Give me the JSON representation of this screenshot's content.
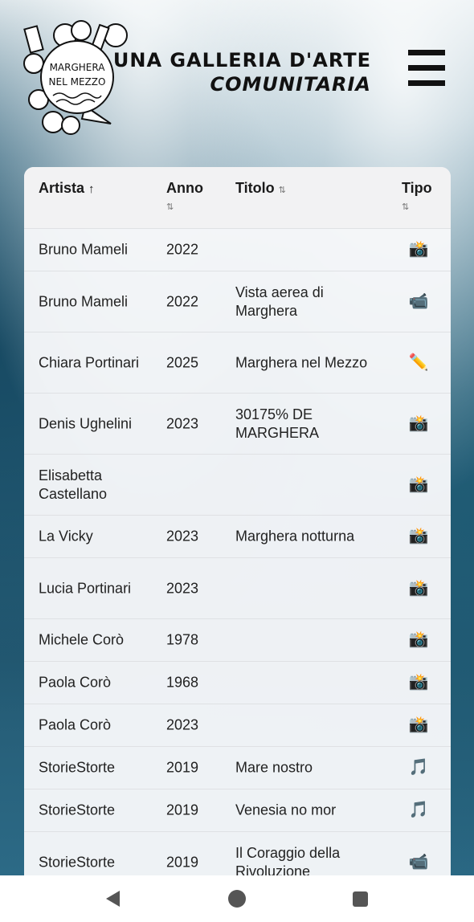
{
  "header": {
    "logo_text_1": "MARGHERA",
    "logo_text_2": "NEL MEZZO",
    "title_line1": "UNA GALLERIA D'ARTE",
    "title_line2": "COMUNITARIA"
  },
  "table": {
    "columns": {
      "artist": "Artista",
      "artist_sort": "↑",
      "year": "Anno",
      "year_sort": "⇅",
      "title": "Titolo",
      "title_sort": "⇅",
      "type": "Tipo",
      "type_sort": "⇅"
    },
    "rows": [
      {
        "artist": "Bruno Mameli",
        "year": "2022",
        "title": "",
        "type": "📸"
      },
      {
        "artist": "Bruno Mameli",
        "year": "2022",
        "title": "Vista aerea di Marghera",
        "type": "📹"
      },
      {
        "artist": "Chiara Portinari",
        "year": "2025",
        "title": "Marghera nel Mezzo",
        "type": "✏️"
      },
      {
        "artist": "Denis Ughelini",
        "year": "2023",
        "title": "30175% DE MARGHERA",
        "type": "📸"
      },
      {
        "artist": "Elisabetta Castellano",
        "year": "",
        "title": "",
        "type": "📸"
      },
      {
        "artist": "La Vicky",
        "year": "2023",
        "title": "Marghera notturna",
        "type": "📸"
      },
      {
        "artist": "Lucia Portinari",
        "year": "2023",
        "title": "",
        "type": "📸"
      },
      {
        "artist": "Michele Corò",
        "year": "1978",
        "title": "",
        "type": "📸"
      },
      {
        "artist": "Paola Corò",
        "year": "1968",
        "title": "",
        "type": "📸"
      },
      {
        "artist": "Paola Corò",
        "year": "2023",
        "title": "",
        "type": "📸"
      },
      {
        "artist": "StorieStorte",
        "year": "2019",
        "title": "Mare nostro",
        "type": "🎵"
      },
      {
        "artist": "StorieStorte",
        "year": "2019",
        "title": "Venesia no mor",
        "type": "🎵"
      },
      {
        "artist": "StorieStorte",
        "year": "2019",
        "title": "Il Coraggio della Rivoluzione",
        "type": "📹"
      }
    ]
  }
}
